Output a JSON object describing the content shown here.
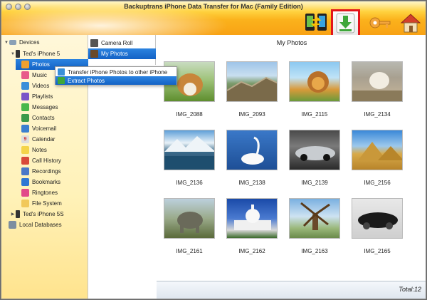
{
  "window": {
    "title": "Backuptrans iPhone Data Transfer for Mac (Family Edition)"
  },
  "toolbar": [
    {
      "name": "transfer-button",
      "icon": "phones-transfer-icon"
    },
    {
      "name": "extract-button",
      "icon": "green-download-arrow-icon",
      "highlighted": true,
      "highlight_color": "#e3141b"
    },
    {
      "name": "register-button",
      "icon": "key-icon"
    },
    {
      "name": "home-button",
      "icon": "home-icon"
    }
  ],
  "sidebar": {
    "root": "Devices",
    "device": "Ted's iPhone 5",
    "items": [
      {
        "label": "Photos",
        "icon": "photos-icon",
        "selected": true
      },
      {
        "label": "Music",
        "icon": "music-icon"
      },
      {
        "label": "Videos",
        "icon": "videos-icon"
      },
      {
        "label": "Playlists",
        "icon": "playlists-icon"
      },
      {
        "label": "Messages",
        "icon": "messages-icon"
      },
      {
        "label": "Contacts",
        "icon": "contacts-icon"
      },
      {
        "label": "Voicemail",
        "icon": "voicemail-icon"
      },
      {
        "label": "Calendar",
        "icon": "calendar-icon",
        "glyph": "9"
      },
      {
        "label": "Notes",
        "icon": "notes-icon"
      },
      {
        "label": "Call History",
        "icon": "call-history-icon"
      },
      {
        "label": "Recordings",
        "icon": "recordings-icon"
      },
      {
        "label": "Bookmarks",
        "icon": "bookmarks-icon"
      },
      {
        "label": "Ringtones",
        "icon": "ringtones-icon"
      },
      {
        "label": "File System",
        "icon": "file-system-icon"
      }
    ],
    "device2": "Ted's iPhone 5S",
    "local": "Local Databases"
  },
  "subnav": [
    {
      "label": "Camera Roll",
      "icon": "camera-roll-icon"
    },
    {
      "label": "My Photos",
      "icon": "my-photos-icon",
      "selected": true
    }
  ],
  "context_menu": [
    {
      "label": "Transfer iPhone Photos to other iPhone",
      "icon": "transfer-photos-icon"
    },
    {
      "label": "Extract Photos",
      "icon": "extract-photos-icon",
      "selected": true
    }
  ],
  "main": {
    "title": "My Photos"
  },
  "photos": [
    {
      "name": "IMG_2088",
      "subject": "dog-on-grass"
    },
    {
      "name": "IMG_2093",
      "subject": "great-wall"
    },
    {
      "name": "IMG_2115",
      "subject": "lion"
    },
    {
      "name": "IMG_2134",
      "subject": "puppy-on-rock"
    },
    {
      "name": "IMG_2136",
      "subject": "mountain-lake"
    },
    {
      "name": "IMG_2138",
      "subject": "swan"
    },
    {
      "name": "IMG_2139",
      "subject": "silver-car"
    },
    {
      "name": "IMG_2156",
      "subject": "pyramids"
    },
    {
      "name": "IMG_2161",
      "subject": "elephant"
    },
    {
      "name": "IMG_2162",
      "subject": "capitol-building"
    },
    {
      "name": "IMG_2163",
      "subject": "windmill"
    },
    {
      "name": "IMG_2165",
      "subject": "black-car"
    }
  ],
  "status": {
    "total": "Total:12"
  },
  "colors": {
    "selection": "#1362c5",
    "sidebar_bg": "#fff2b9",
    "titlebar": "#fbb21c",
    "highlight": "#e3141b"
  }
}
